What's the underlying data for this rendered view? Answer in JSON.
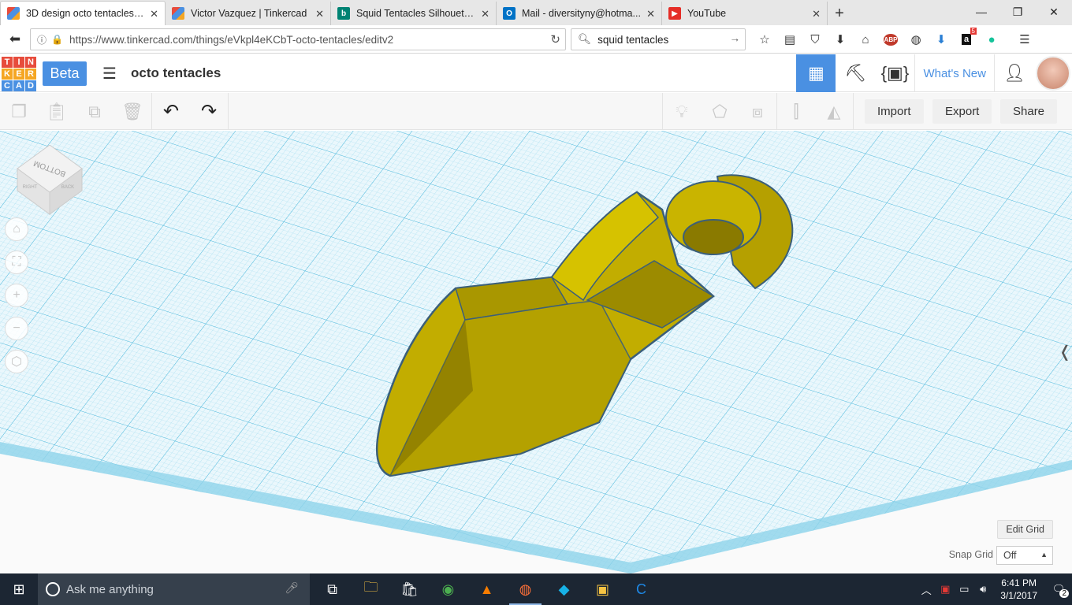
{
  "browser": {
    "tabs": [
      {
        "title": "3D design octo tentacles | ...",
        "active": true,
        "icon": "tinkercad-favicon",
        "color": "#e74c3c"
      },
      {
        "title": "Victor Vazquez | Tinkercad",
        "active": false,
        "icon": "tinkercad-favicon",
        "color": "#e74c3c"
      },
      {
        "title": "Squid Tentacles Silhouette...",
        "active": false,
        "icon": "bing-icon",
        "color": "#008373"
      },
      {
        "title": "Mail - diversityny@hotma...",
        "active": false,
        "icon": "outlook-icon",
        "color": "#0072c6"
      },
      {
        "title": "YouTube",
        "active": false,
        "icon": "youtube-icon",
        "color": "#e52d27"
      }
    ],
    "url": "https://www.tinkercad.com/things/eVkpl4eKCbT-octo-tentacles/editv2",
    "search": "squid tentacles",
    "abp_badge": "ABP",
    "amazon_count": "5"
  },
  "tinkercad": {
    "logo_letters": [
      "T",
      "I",
      "N",
      "K",
      "E",
      "R",
      "C",
      "A",
      "D"
    ],
    "beta_label": "Beta",
    "project_title": "octo tentacles",
    "whats_new": "What's New",
    "import_label": "Import",
    "export_label": "Export",
    "share_label": "Share",
    "viewcube_labels": {
      "top": "BOTTOM",
      "left": "RIGHT",
      "right": "BACK"
    },
    "edit_grid_label": "Edit Grid",
    "snap_grid_label": "Snap Grid",
    "snap_grid_value": "Off",
    "accent_color": "#4a90e2",
    "grid_color": "#5bc0de",
    "shape_color": "#c8b000"
  },
  "taskbar": {
    "search_placeholder": "Ask me anything",
    "time": "6:41 PM",
    "date": "3/1/2017",
    "notifications": "2"
  }
}
